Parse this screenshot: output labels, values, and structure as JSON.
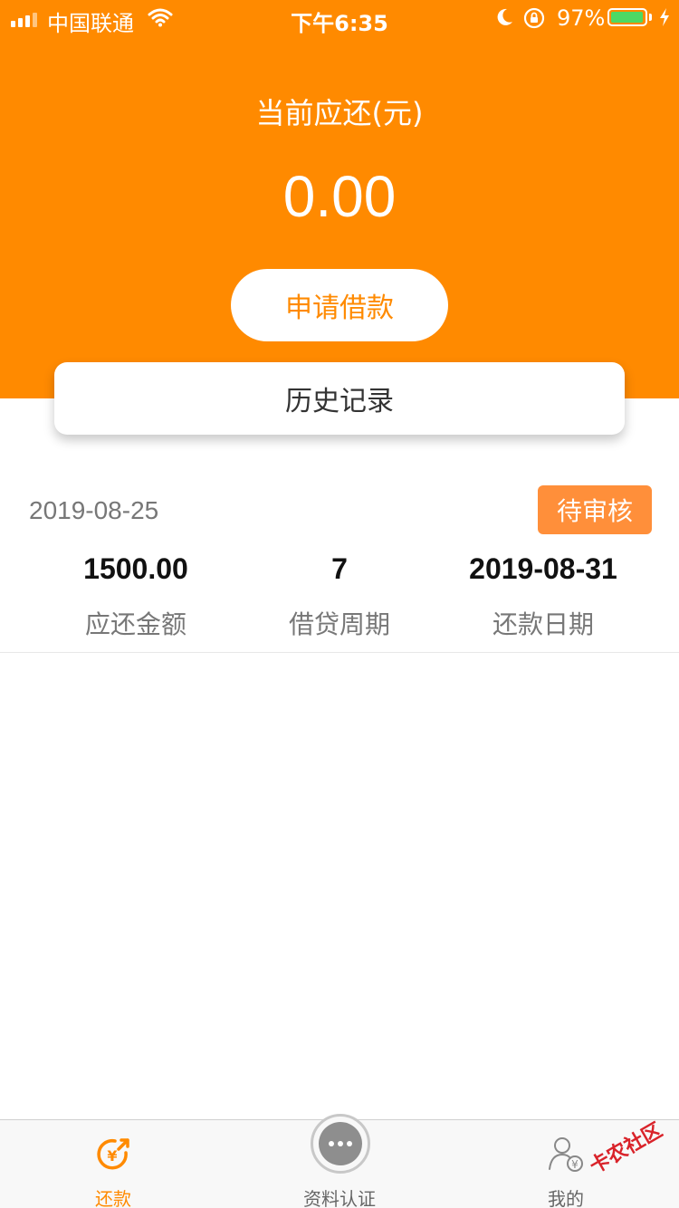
{
  "status_bar": {
    "carrier": "中国联通",
    "time": "下午6:35",
    "battery_percent": "97%"
  },
  "header": {
    "due_label": "当前应还(元)",
    "due_amount": "0.00",
    "apply_button": "申请借款",
    "history_title": "历史记录"
  },
  "record": {
    "date": "2019-08-25",
    "status": "待审核",
    "stats": [
      {
        "value": "1500.00",
        "label": "应还金额"
      },
      {
        "value": "7",
        "label": "借贷周期"
      },
      {
        "value": "2019-08-31",
        "label": "还款日期"
      }
    ]
  },
  "tabs": [
    {
      "label": "还款",
      "icon": "repay-yen-icon",
      "active": true
    },
    {
      "label": "资料认证",
      "icon": "more-dots-icon",
      "active": false
    },
    {
      "label": "我的",
      "icon": "user-yen-icon",
      "active": false
    }
  ],
  "watermark": "卡农社区",
  "colors": {
    "brand": "#ff8a00",
    "badge": "#ff8f3a",
    "tab_active": "#ff8a00",
    "tab_inactive": "#666666",
    "battery": "#4cd964"
  }
}
